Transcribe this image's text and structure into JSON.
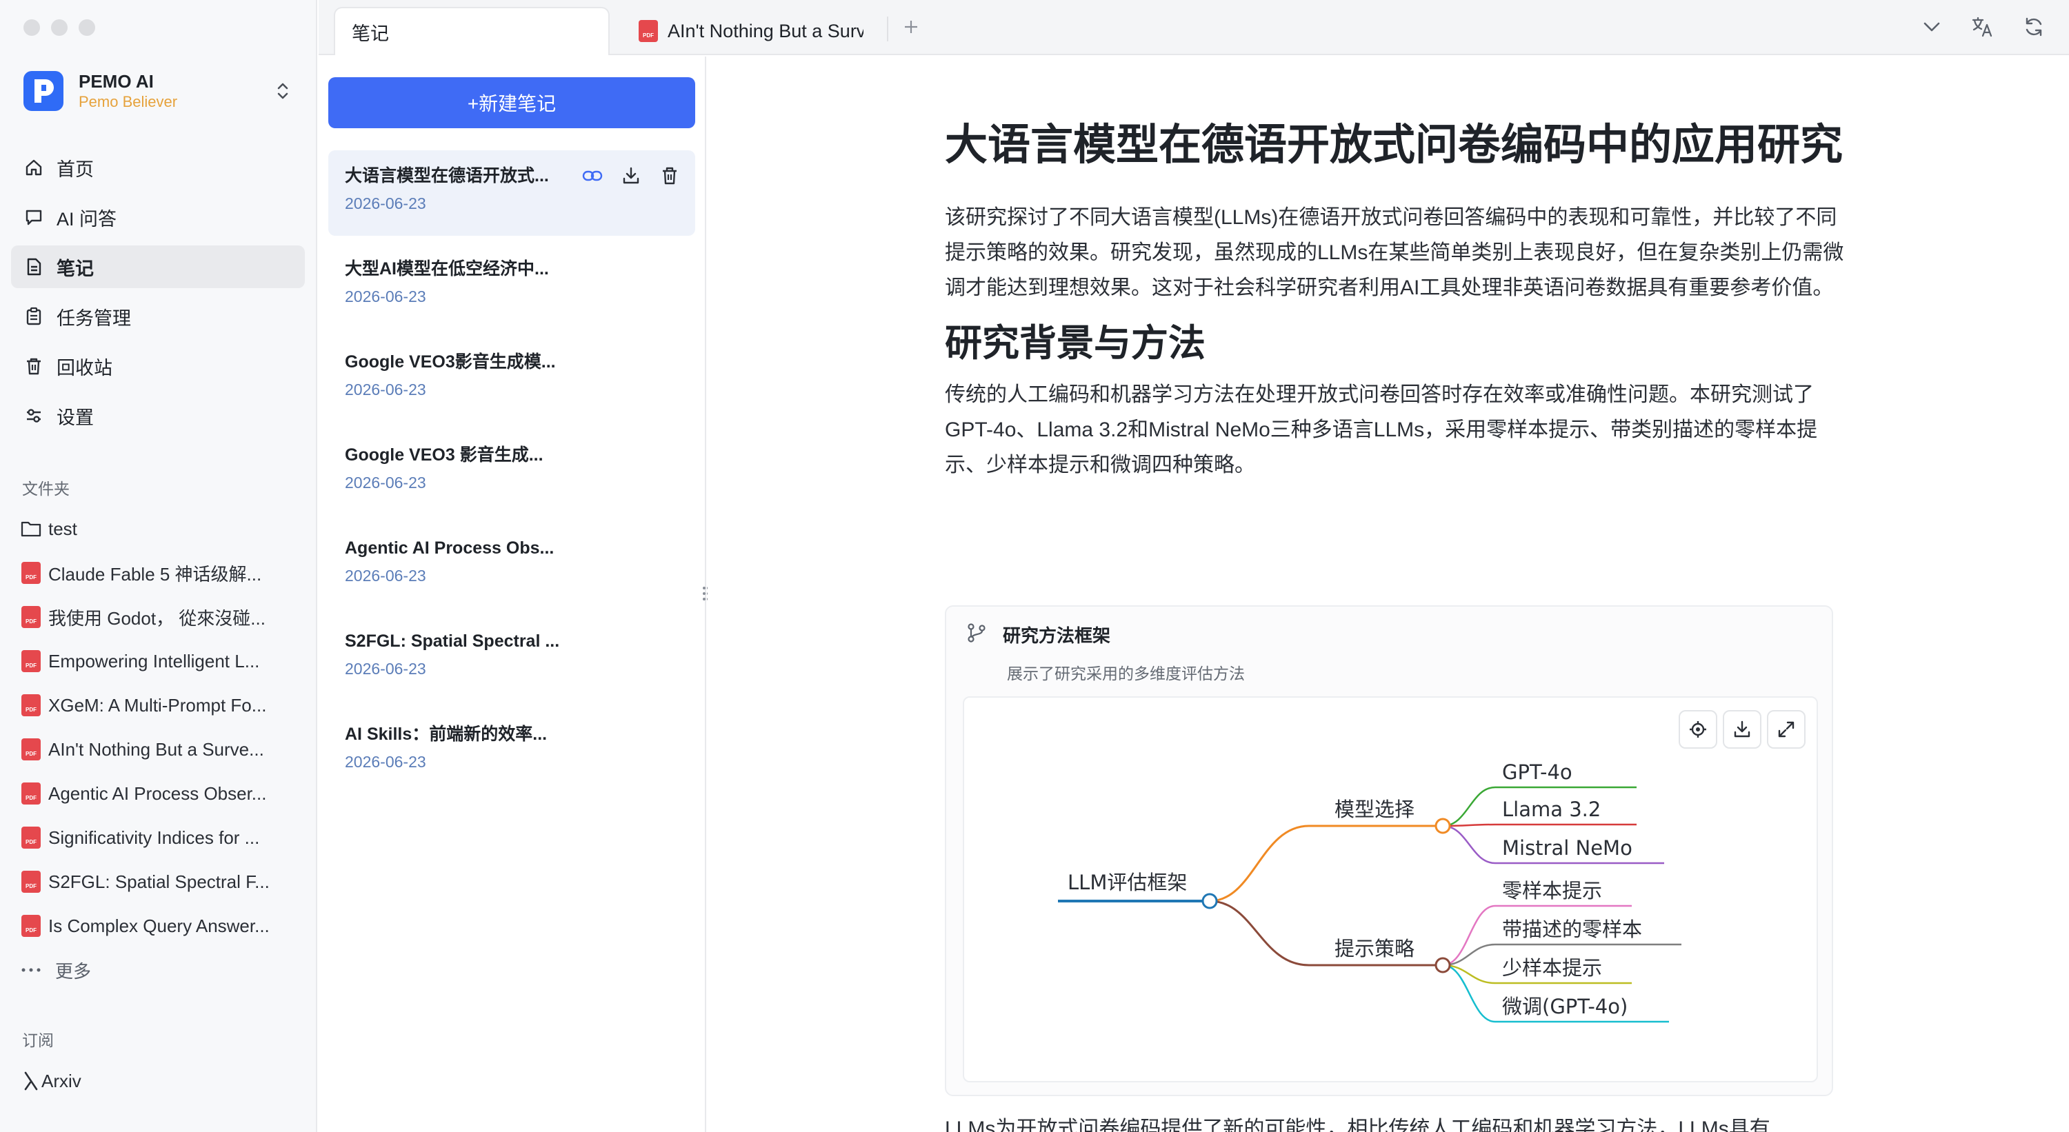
{
  "sidebar": {
    "brand": {
      "name": "PEMO AI",
      "subtitle": "Pemo Believer"
    },
    "nav": [
      {
        "label": "首页",
        "icon": "home-icon"
      },
      {
        "label": "AI 问答",
        "icon": "chat-icon"
      },
      {
        "label": "笔记",
        "icon": "note-icon",
        "active": true
      },
      {
        "label": "任务管理",
        "icon": "clipboard-icon"
      },
      {
        "label": "回收站",
        "icon": "trash-icon"
      },
      {
        "label": "设置",
        "icon": "settings-icon"
      }
    ],
    "folders_title": "文件夹",
    "folders": [
      {
        "label": "test",
        "type": "folder"
      },
      {
        "label": "Claude Fable 5 神话级解...",
        "type": "pdf"
      },
      {
        "label": "我使用 Godot， 從來沒碰...",
        "type": "pdf"
      },
      {
        "label": "Empowering Intelligent L...",
        "type": "pdf"
      },
      {
        "label": "XGeM: A Multi-Prompt Fo...",
        "type": "pdf"
      },
      {
        "label": "AIn't Nothing But a Surve...",
        "type": "pdf"
      },
      {
        "label": "Agentic AI Process Obser...",
        "type": "pdf"
      },
      {
        "label": "Significativity Indices for ...",
        "type": "pdf"
      },
      {
        "label": "S2FGL: Spatial Spectral F...",
        "type": "pdf"
      },
      {
        "label": "Is Complex Query Answer...",
        "type": "pdf"
      }
    ],
    "more_label": "更多",
    "subscriptions_title": "订阅",
    "subscriptions": [
      {
        "label": "Arxiv"
      }
    ]
  },
  "tabs": [
    {
      "label": "笔记",
      "active": true
    },
    {
      "label": "AIn't Nothing But a Surv",
      "type": "pdf"
    }
  ],
  "notelist": {
    "new_button": "+新建笔记",
    "notes": [
      {
        "title": "大语言模型在德语开放式...",
        "date": "2026-06-23",
        "active": true
      },
      {
        "title": "大型AI模型在低空经济中...",
        "date": "2026-06-23"
      },
      {
        "title": "Google VEO3影音生成模...",
        "date": "2026-06-23"
      },
      {
        "title": "Google VEO3 影音生成...",
        "date": "2026-06-23"
      },
      {
        "title": "Agentic AI Process Obs...",
        "date": "2026-06-23"
      },
      {
        "title": "S2FGL: Spatial Spectral ...",
        "date": "2026-06-23"
      },
      {
        "title": "AI Skills：前端新的效率...",
        "date": "2026-06-23"
      }
    ]
  },
  "article": {
    "title": "大语言模型在德语开放式问卷编码中的应用研究",
    "intro": "该研究探讨了不同大语言模型(LLMs)在德语开放式问卷回答编码中的表现和可靠性，并比较了不同提示策略的效果。研究发现，虽然现成的LLMs在某些简单类别上表现良好，但在复杂类别上仍需微调才能达到理想效果。这对于社会科学研究者利用AI工具处理非英语问卷数据具有重要参考价值。",
    "section1_title": "研究背景与方法",
    "section1_text": "传统的人工编码和机器学习方法在处理开放式问卷回答时存在效率或准确性问题。本研究测试了GPT-4o、Llama 3.2和Mistral NeMo三种多语言LLMs，采用零样本提示、带类别描述的零样本提示、少样本提示和微调四种策略。",
    "diagram": {
      "title": "研究方法框架",
      "subtitle": "展示了研究采用的多维度评估方法",
      "root": "LLM评估框架",
      "branches": [
        {
          "label": "模型选择",
          "color": "#f08a24",
          "children": [
            {
              "label": "GPT-4o",
              "color": "#3aa835"
            },
            {
              "label": "Llama 3.2",
              "color": "#d63b3b"
            },
            {
              "label": "Mistral NeMo",
              "color": "#9a5cc6"
            }
          ]
        },
        {
          "label": "提示策略",
          "color": "#8b4a3a",
          "children": [
            {
              "label": "零样本提示",
              "color": "#e377c2"
            },
            {
              "label": "带描述的零样本",
              "color": "#7f7f7f"
            },
            {
              "label": "少样本提示",
              "color": "#bcbd22"
            },
            {
              "label": "微调(GPT-4o)",
              "color": "#17becf"
            }
          ]
        }
      ],
      "root_color": "#1f77b4"
    },
    "bottom_text": "LLMs为开放式问卷编码提供了新的可能性，相比传统人工编码和机器学习方法，LLMs具有"
  }
}
